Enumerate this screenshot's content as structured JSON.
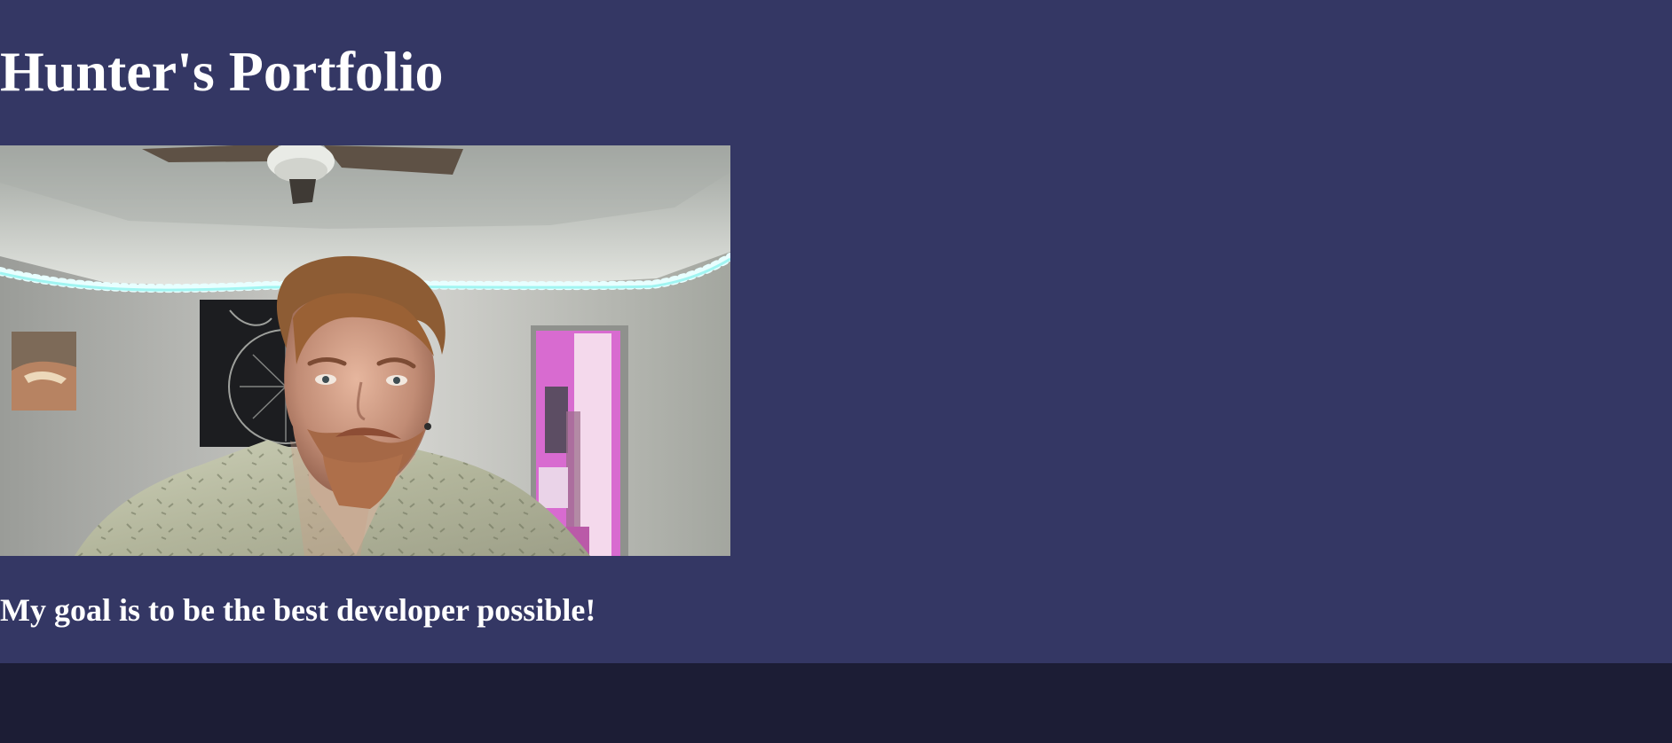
{
  "header": {
    "title": "Hunter's Portfolio"
  },
  "hero": {
    "photo_subject": "portrait-photo",
    "goal_text": "My goal is to be the best developer possible!"
  },
  "colors": {
    "hero_background": "#343764",
    "footer_background": "#1c1d35",
    "text": "#ffffff"
  }
}
